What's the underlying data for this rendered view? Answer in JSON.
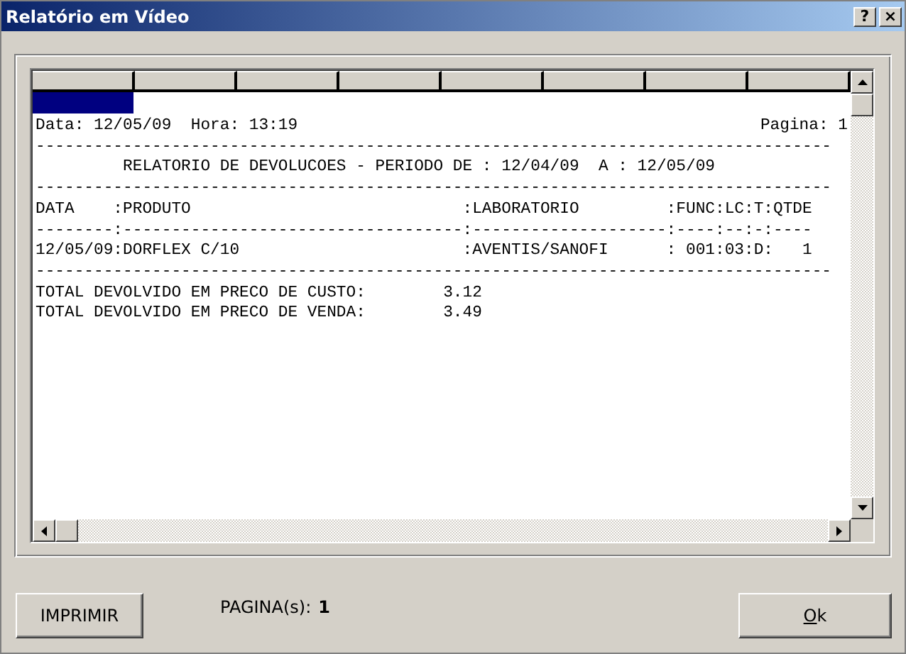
{
  "window": {
    "title": "Relatório em Vídeo",
    "buttons": [
      "?",
      "×"
    ]
  },
  "report": {
    "date_line": "Data: 12/05/09  Hora: 13:19",
    "page_line": "Pagina: 1",
    "lines": [
      "----------------------------------------------------------------------------------",
      "         RELATORIO DE DEVOLUCOES - PERIODO DE : 12/04/09  A : 12/05/09",
      "----------------------------------------------------------------------------------",
      "DATA    :PRODUTO                            :LABORATORIO         :FUNC:LC:T:QTDE",
      "--------:-----------------------------------:--------------------:----:--:-:----",
      "12/05/09:DORFLEX C/10                       :AVENTIS/SANOFI      : 001:03:D:   1",
      "----------------------------------------------------------------------------------",
      "TOTAL DEVOLVIDO EM PRECO DE CUSTO:        3.12",
      "TOTAL DEVOLVIDO EM PRECO DE VENDA:        3.49"
    ]
  },
  "footer": {
    "print_button": "IMPRIMIR",
    "pages_label": "PAGINA(s):",
    "pages_value": "1",
    "ok_button": "Ok"
  }
}
